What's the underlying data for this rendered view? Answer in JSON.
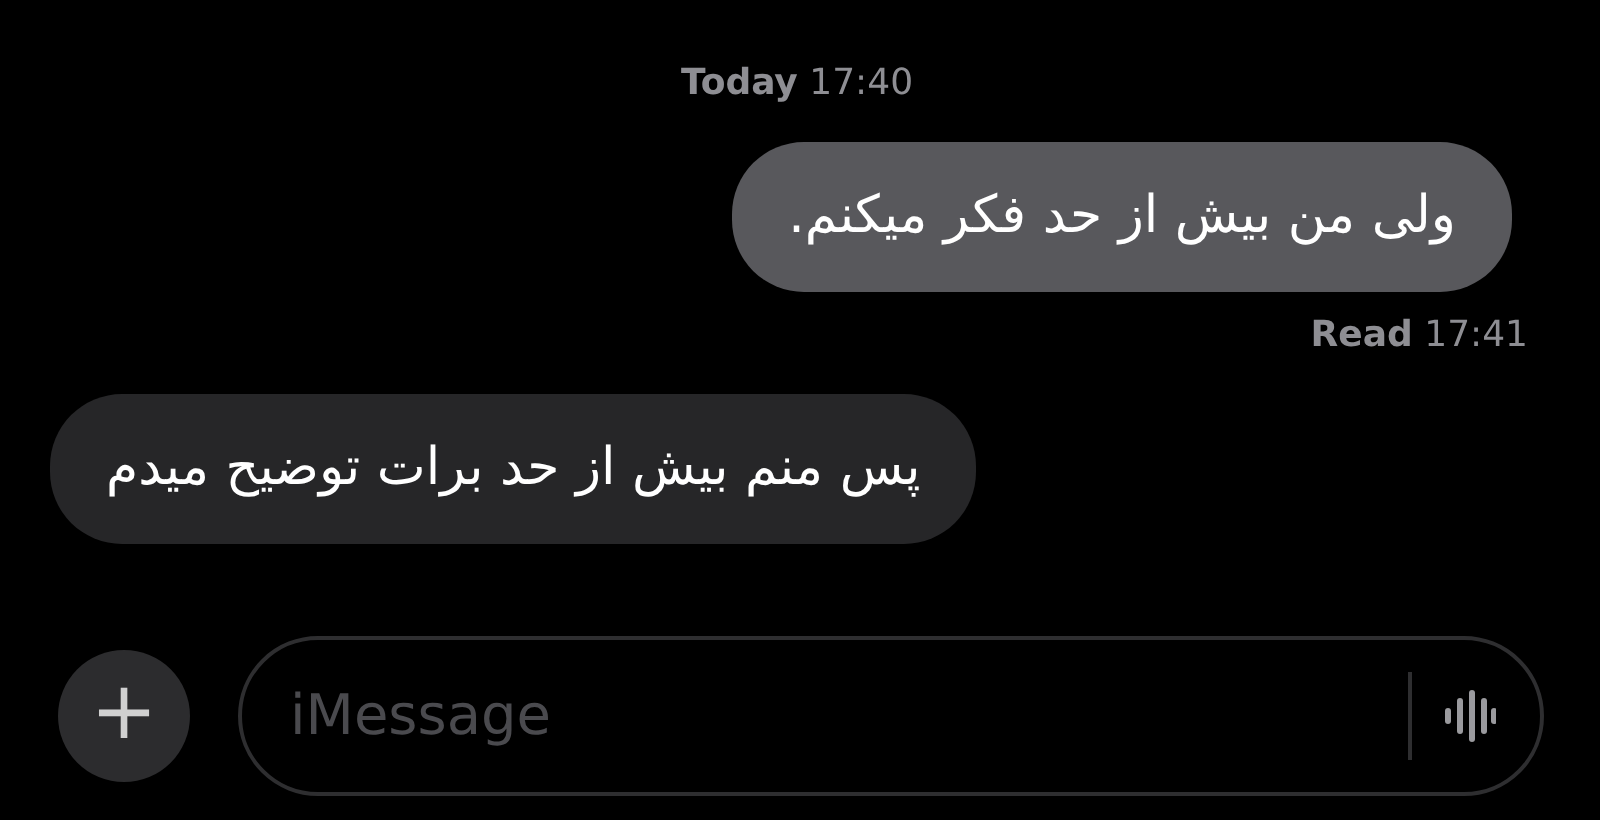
{
  "messages": [
    {
      "kind": "timestamp",
      "text": "**Today** 17:40"
    },
    {
      "kind": "outgoing",
      "text": "ولی من بیش از حد فکر میکنم."
    },
    {
      "kind": "receipt",
      "text": "**Read** 17:41"
    },
    {
      "kind": "incoming",
      "text": "پس منم بیش از حد برات توضیح میدم"
    }
  ],
  "composer": {
    "add_label": "+",
    "placeholder": "iMessage"
  }
}
